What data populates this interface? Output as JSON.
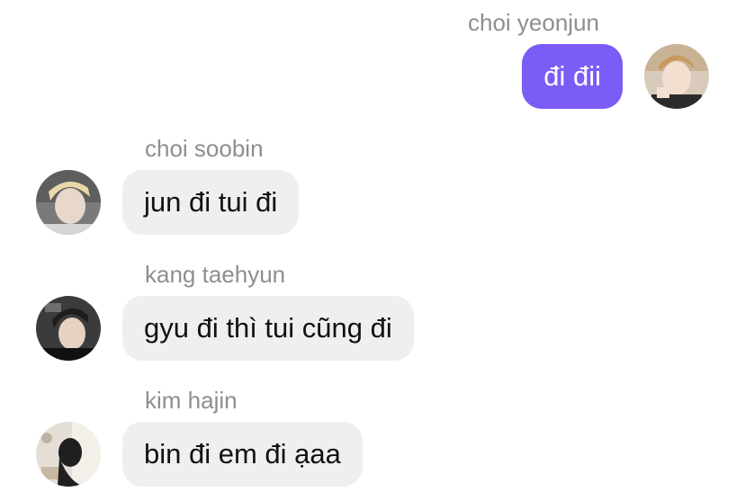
{
  "chat": {
    "messages": [
      {
        "sender": "choi yeonjun",
        "text": "đi đii",
        "direction": "outgoing",
        "avatar": "avatar-yeonjun"
      },
      {
        "sender": "choi soobin",
        "text": "jun đi tui đi",
        "direction": "incoming",
        "avatar": "avatar-soobin"
      },
      {
        "sender": "kang taehyun",
        "text": "gyu đi thì tui cũng đi",
        "direction": "incoming",
        "avatar": "avatar-taehyun"
      },
      {
        "sender": "kim hajin",
        "text": "bin đi em đi ạaa",
        "direction": "incoming",
        "avatar": "avatar-hajin"
      }
    ]
  },
  "colors": {
    "outgoing_bubble": "#7b5cf6",
    "incoming_bubble": "#efeff1",
    "sender_name": "#8e8e93"
  }
}
